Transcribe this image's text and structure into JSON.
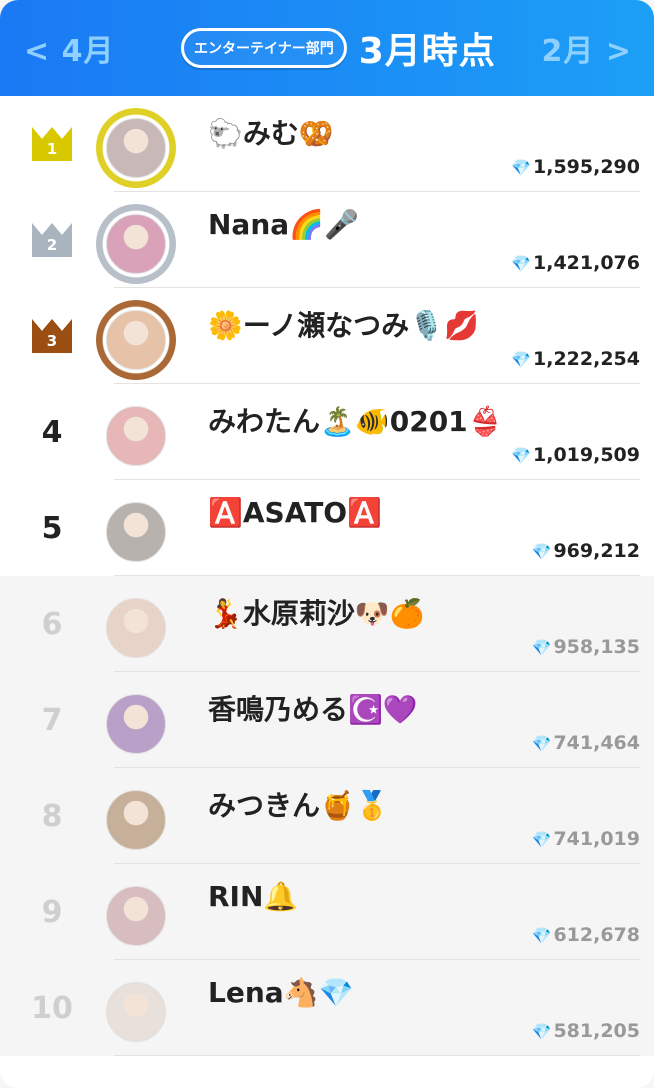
{
  "header": {
    "prev_label": "< 4月",
    "category_label": "エンターテイナー部門",
    "current_label": "3月時点",
    "next_label": "2月 >"
  },
  "gem_icon": "💎",
  "colors": {
    "header_start": "#1a79f4",
    "header_end": "#1c9ff6",
    "gold": "#d8c800",
    "silver": "#aab4bf",
    "bronze": "#9b4e12"
  },
  "rankings": [
    {
      "rank": "1",
      "name": "🐑みむ🥨",
      "score": "1,595,290",
      "crown": "gold",
      "faded": false,
      "avatar": "#c9b8b8"
    },
    {
      "rank": "2",
      "name": "Nana🌈🎤",
      "score": "1,421,076",
      "crown": "silver",
      "faded": false,
      "avatar": "#d9a2b8"
    },
    {
      "rank": "3",
      "name": "🌼ーノ瀬なつみ🎙️💋",
      "score": "1,222,254",
      "crown": "bronze",
      "faded": false,
      "avatar": "#e6c2a8"
    },
    {
      "rank": "4",
      "name": "みわたん🏝️🐠0201👙",
      "score": "1,019,509",
      "crown": "",
      "faded": false,
      "avatar": "#e7b7b7"
    },
    {
      "rank": "5",
      "name": "🅰️ASATO🅰️",
      "score": "969,212",
      "crown": "",
      "faded": false,
      "avatar": "#b8b2ae"
    },
    {
      "rank": "6",
      "name": "💃水原莉沙🐶🍊",
      "score": "958,135",
      "crown": "",
      "faded": true,
      "avatar": "#e8d3c8"
    },
    {
      "rank": "7",
      "name": "香鳴乃める☪️💜",
      "score": "741,464",
      "crown": "",
      "faded": true,
      "avatar": "#b9a0c8"
    },
    {
      "rank": "8",
      "name": "みつきん🍯🥇",
      "score": "741,019",
      "crown": "",
      "faded": true,
      "avatar": "#c7b09a"
    },
    {
      "rank": "9",
      "name": "RIN🔔",
      "score": "612,678",
      "crown": "",
      "faded": true,
      "avatar": "#d7bcc0"
    },
    {
      "rank": "10",
      "name": "Lena🐴💎",
      "score": "581,205",
      "crown": "",
      "faded": true,
      "avatar": "#e8e0db"
    }
  ]
}
